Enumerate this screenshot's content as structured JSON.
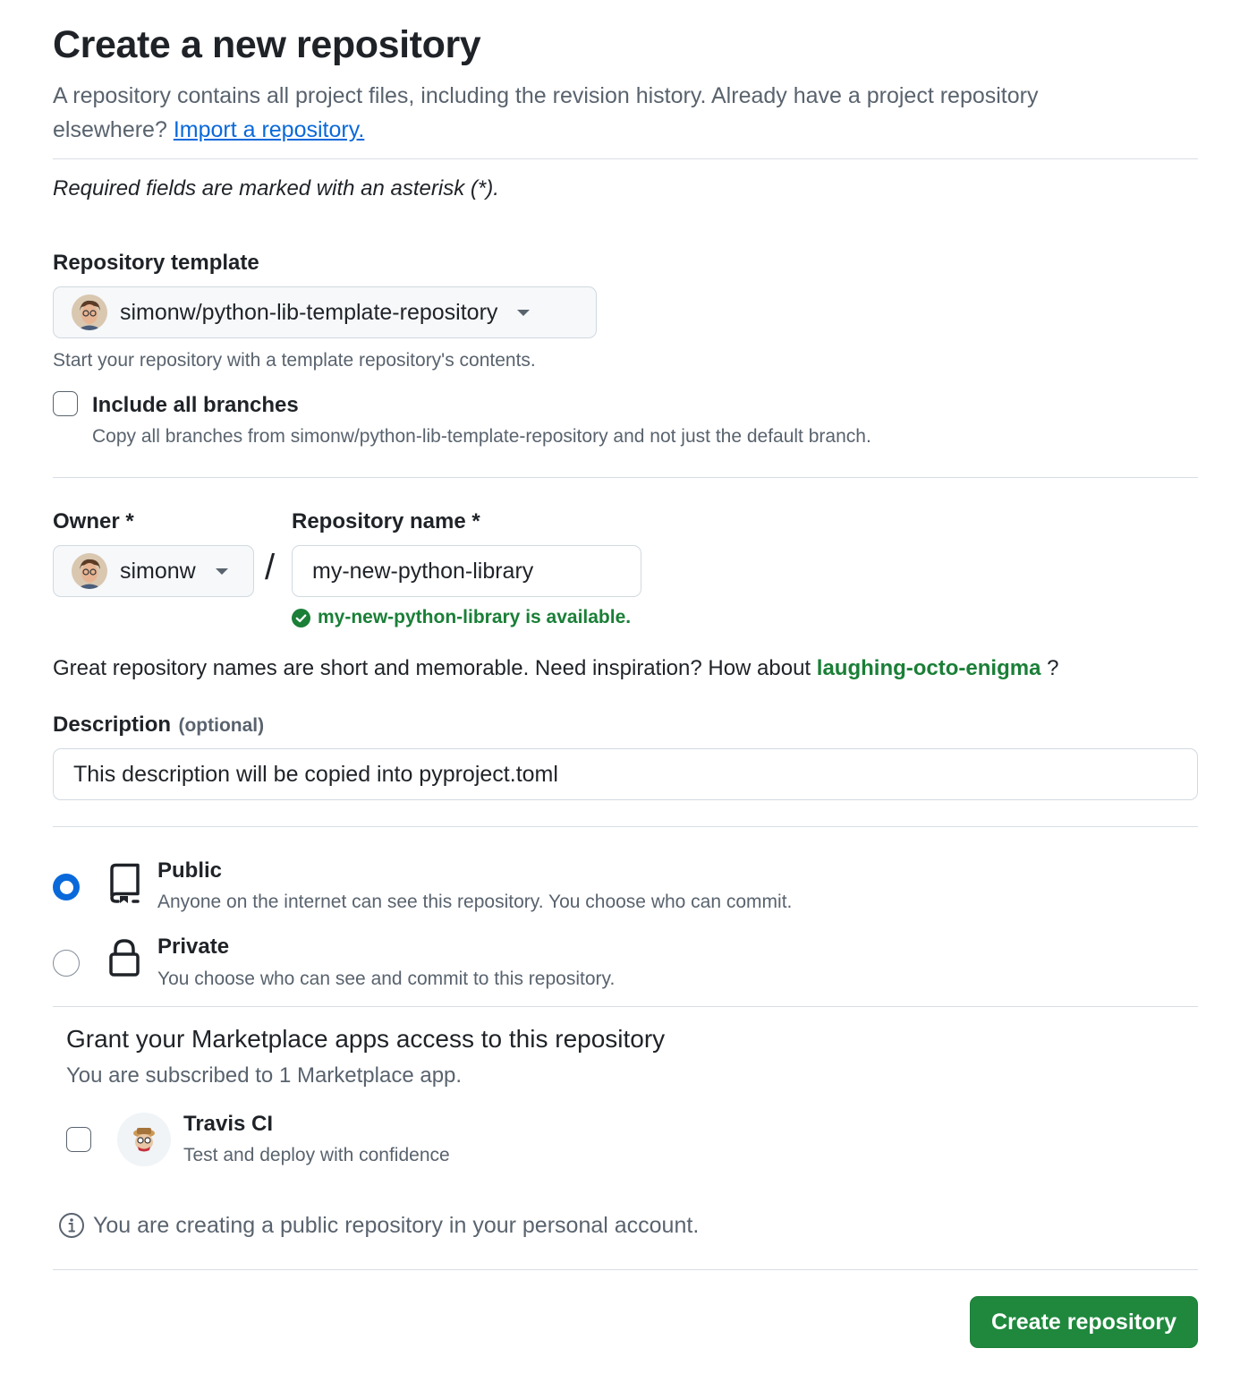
{
  "header": {
    "title": "Create a new repository",
    "intro_text": "A repository contains all project files, including the revision history. Already have a project repository elsewhere?",
    "import_link": "Import a repository."
  },
  "required_note": "Required fields are marked with an asterisk (*).",
  "template": {
    "label": "Repository template",
    "selected": "simonw/python-lib-template-repository",
    "help": "Start your repository with a template repository's contents.",
    "include_branches_label": "Include all branches",
    "include_branches_help": "Copy all branches from simonw/python-lib-template-repository and not just the default branch.",
    "include_branches_checked": false
  },
  "owner": {
    "label": "Owner *",
    "selected": "simonw"
  },
  "separator": "/",
  "repo_name": {
    "label": "Repository name *",
    "value": "my-new-python-library",
    "available_msg": "my-new-python-library is available."
  },
  "suggestion": {
    "text_before": "Great repository names are short and memorable. Need inspiration? How about",
    "name": "laughing-octo-enigma",
    "text_after": "?"
  },
  "description": {
    "label": "Description",
    "optional": "(optional)",
    "value": "This description will be copied into pyproject.toml"
  },
  "visibility": {
    "selected": "public",
    "public_label": "Public",
    "public_help": "Anyone on the internet can see this repository. You choose who can commit.",
    "private_label": "Private",
    "private_help": "You choose who can see and commit to this repository."
  },
  "marketplace": {
    "heading": "Grant your Marketplace apps access to this repository",
    "subheading": "You are subscribed to 1 Marketplace app.",
    "app_name": "Travis CI",
    "app_desc": "Test and deploy with confidence",
    "app_checked": false
  },
  "notice": "You are creating a public repository in your personal account.",
  "submit_label": "Create repository",
  "colors": {
    "accent_blue": "#0969da",
    "success_green": "#1a7f37",
    "button_green": "#1f883d"
  }
}
